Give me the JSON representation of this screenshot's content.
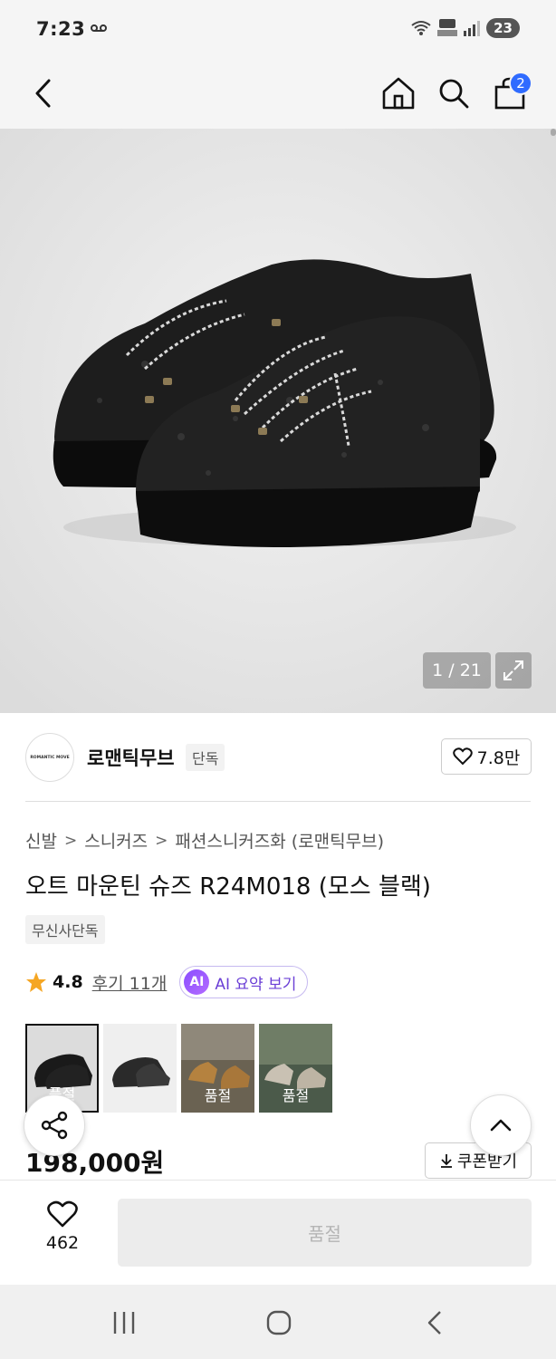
{
  "status": {
    "time": "7:23",
    "battery": "23"
  },
  "nav": {
    "cart_count": "2"
  },
  "gallery": {
    "counter": "1 / 21"
  },
  "brand": {
    "logo_text": "ROMANTIC MOVE",
    "name": "로맨틱무브",
    "tag": "단독",
    "likes": "7.8만"
  },
  "breadcrumb": [
    "신발",
    "스니커즈",
    "패션스니커즈화 (로맨틱무브)"
  ],
  "product": {
    "title": "오트 마운틴 슈즈 R24M018 (모스 블랙)",
    "exclusive": "무신사단독"
  },
  "rating": {
    "value": "4.8",
    "reviews": "후기 11개",
    "ai_summary": "AI 요약 보기",
    "ai_badge": "AI"
  },
  "thumbnails": [
    {
      "label": "품절"
    },
    {
      "label": ""
    },
    {
      "label": "품절"
    },
    {
      "label": "품절"
    }
  ],
  "price": {
    "amount": "198,000원",
    "coupon": "쿠폰받기"
  },
  "bottom": {
    "wish_count": "462",
    "buy_button": "품절"
  },
  "colors": {
    "accent": "#2f6bff",
    "ai_purple": "#8a4dff",
    "disabled": "#ececec"
  }
}
